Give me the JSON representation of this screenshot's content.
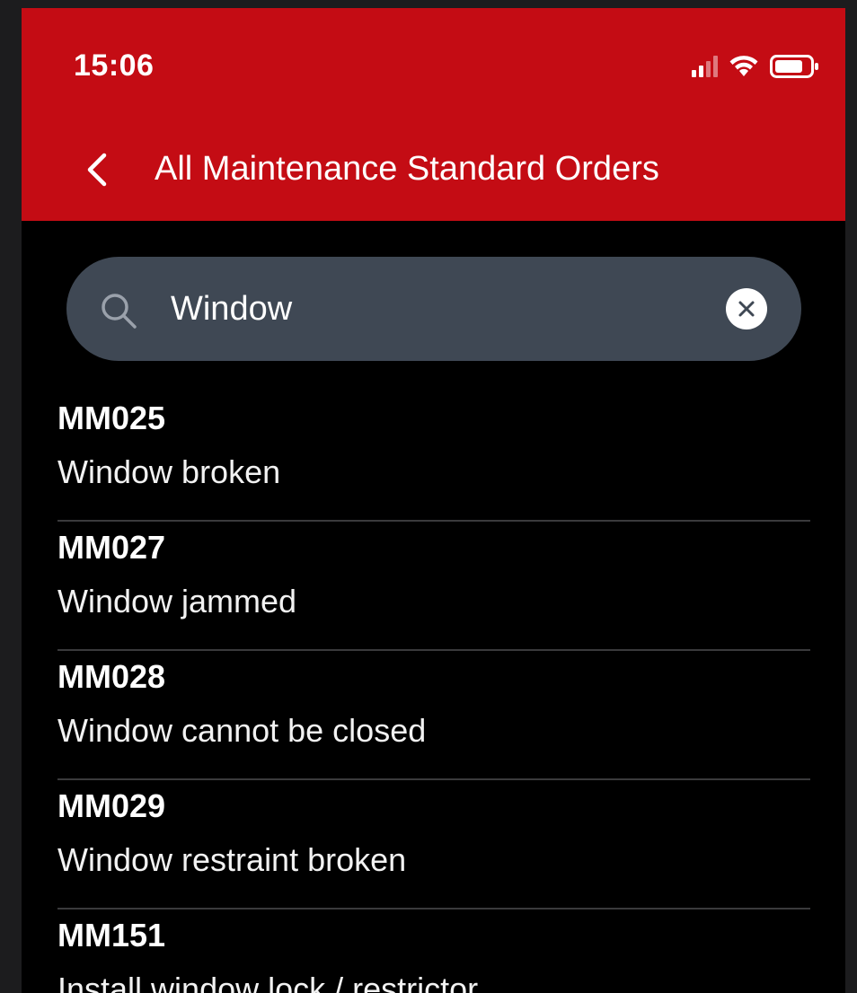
{
  "status_bar": {
    "time": "15:06"
  },
  "header": {
    "title": "All Maintenance Standard Orders",
    "background_color": "#c40c14"
  },
  "search": {
    "value": "Window",
    "background_color": "#3f4854"
  },
  "orders": [
    {
      "code": "MM025",
      "description": "Window broken"
    },
    {
      "code": "MM027",
      "description": "Window jammed"
    },
    {
      "code": "MM028",
      "description": "Window cannot be closed"
    },
    {
      "code": "MM029",
      "description": "Window restraint broken"
    },
    {
      "code": "MM151",
      "description": "Install window lock / restrictor"
    }
  ]
}
